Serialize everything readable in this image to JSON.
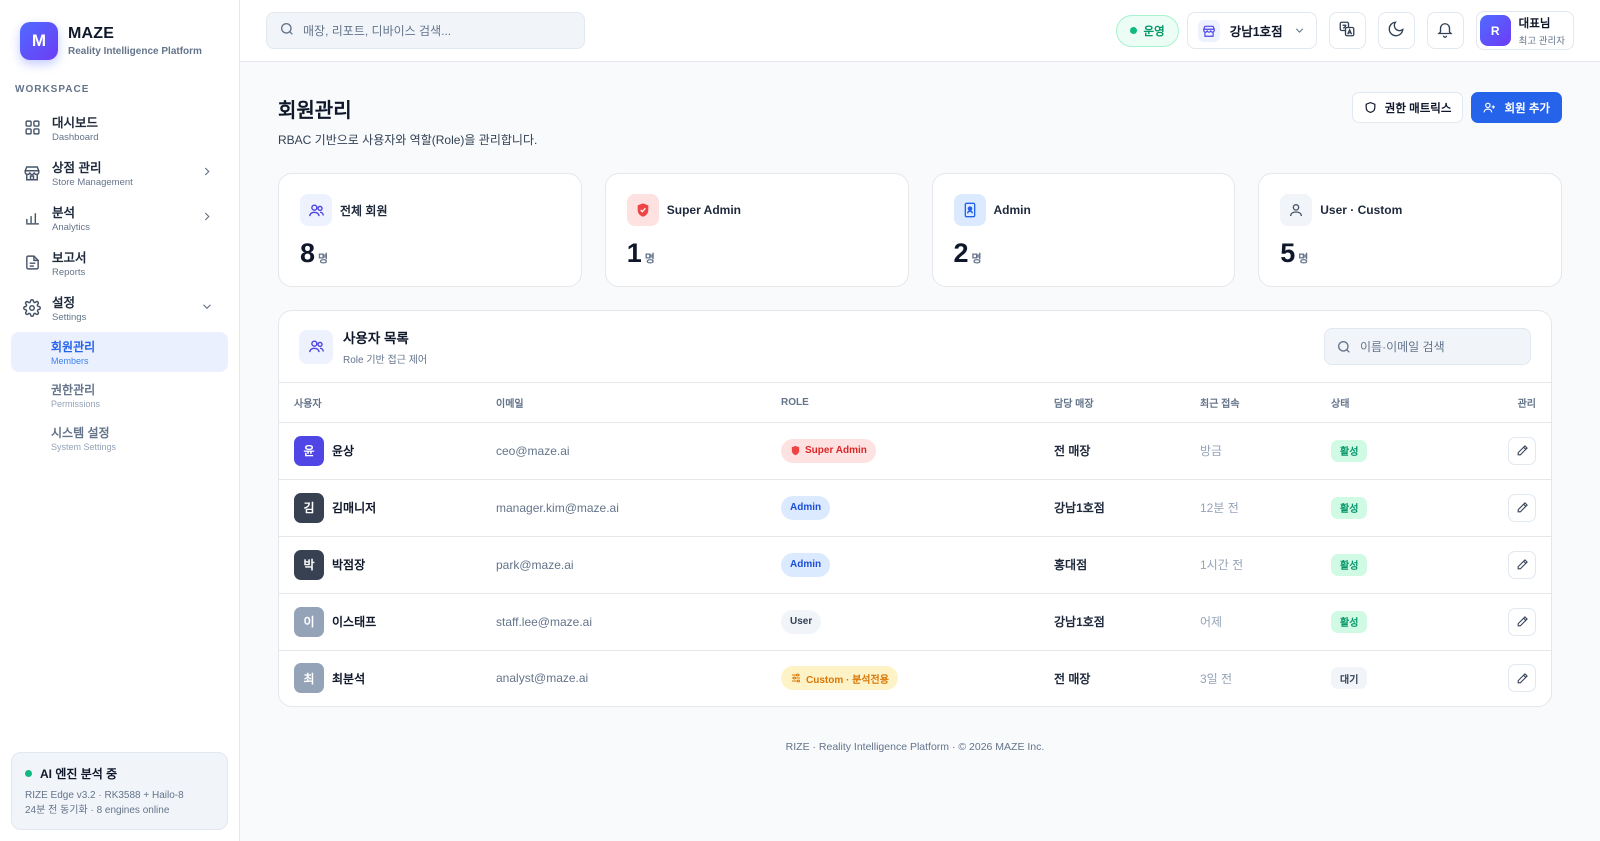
{
  "brand": {
    "logo_letter": "M",
    "name": "MAZE",
    "subtitle": "Reality Intelligence Platform"
  },
  "sidebar": {
    "section_label": "WORKSPACE",
    "items": [
      {
        "title": "대시보드",
        "subtitle": "Dashboard",
        "icon": "grid-icon"
      },
      {
        "title": "상점 관리",
        "subtitle": "Store Management",
        "icon": "store-icon"
      },
      {
        "title": "분석",
        "subtitle": "Analytics",
        "icon": "bar-chart-icon"
      },
      {
        "title": "보고서",
        "subtitle": "Reports",
        "icon": "document-icon"
      },
      {
        "title": "설정",
        "subtitle": "Settings",
        "icon": "gear-icon"
      }
    ],
    "settings_sub": [
      {
        "title": "회원관리",
        "subtitle": "Members",
        "active": true
      },
      {
        "title": "권한관리",
        "subtitle": "Permissions",
        "active": false
      },
      {
        "title": "시스템 설정",
        "subtitle": "System Settings",
        "active": false
      }
    ],
    "ai_card": {
      "title": "AI 엔진 분석 중",
      "line1": "RIZE Edge v3.2 · RK3588 + Hailo-8",
      "line2": "24분 전 동기화 · 8 engines online"
    }
  },
  "topbar": {
    "search_placeholder": "매장, 리포트, 디바이스 검색...",
    "status": "운영",
    "store": "강남1호점",
    "user": {
      "initial": "R",
      "name": "대표님",
      "role": "최고 관리자"
    }
  },
  "page": {
    "title": "회원관리",
    "description": "RBAC 기반으로 사용자와 역할(Role)을 관리합니다.",
    "btn_matrix": "권한 매트릭스",
    "btn_add": "회원 추가"
  },
  "stats": [
    {
      "label": "전체 회원",
      "value": "8",
      "unit": "명",
      "icon": "users-icon",
      "bg": "#eef2ff",
      "color": "#4f46e5"
    },
    {
      "label": "Super Admin",
      "value": "1",
      "unit": "명",
      "icon": "shield-icon",
      "bg": "#fee2e2",
      "color": "#ef4444"
    },
    {
      "label": "Admin",
      "value": "2",
      "unit": "명",
      "icon": "id-badge-icon",
      "bg": "#dbeafe",
      "color": "#2563eb"
    },
    {
      "label": "User · Custom",
      "value": "5",
      "unit": "명",
      "icon": "user-icon",
      "bg": "#f1f5f9",
      "color": "#475569"
    }
  ],
  "user_list": {
    "title": "사용자 목록",
    "subtitle": "Role 기반 접근 제어",
    "search_placeholder": "이름·이메일 검색",
    "columns": [
      "사용자",
      "이메일",
      "ROLE",
      "담당 매장",
      "최근 접속",
      "상태",
      "관리"
    ],
    "rows": [
      {
        "initial": "윤",
        "name": "윤상",
        "email": "ceo@maze.ai",
        "role": "Super Admin",
        "role_type": "super",
        "store": "전 매장",
        "last": "방금",
        "status": "활성",
        "status_type": "active",
        "avatar_bg": "#4f46e5"
      },
      {
        "initial": "김",
        "name": "김매니저",
        "email": "manager.kim@maze.ai",
        "role": "Admin",
        "role_type": "admin",
        "store": "강남1호점",
        "last": "12분 전",
        "status": "활성",
        "status_type": "active",
        "avatar_bg": "#374151"
      },
      {
        "initial": "박",
        "name": "박점장",
        "email": "park@maze.ai",
        "role": "Admin",
        "role_type": "admin",
        "store": "홍대점",
        "last": "1시간 전",
        "status": "활성",
        "status_type": "active",
        "avatar_bg": "#374151"
      },
      {
        "initial": "이",
        "name": "이스태프",
        "email": "staff.lee@maze.ai",
        "role": "User",
        "role_type": "user",
        "store": "강남1호점",
        "last": "어제",
        "status": "활성",
        "status_type": "active",
        "avatar_bg": "#94a3b8"
      },
      {
        "initial": "최",
        "name": "최분석",
        "email": "analyst@maze.ai",
        "role": "Custom · 분석전용",
        "role_type": "custom",
        "store": "전 매장",
        "last": "3일 전",
        "status": "대기",
        "status_type": "pending",
        "avatar_bg": "#94a3b8"
      }
    ]
  },
  "footer": "RIZE · Reality Intelligence Platform · © 2026 MAZE Inc."
}
